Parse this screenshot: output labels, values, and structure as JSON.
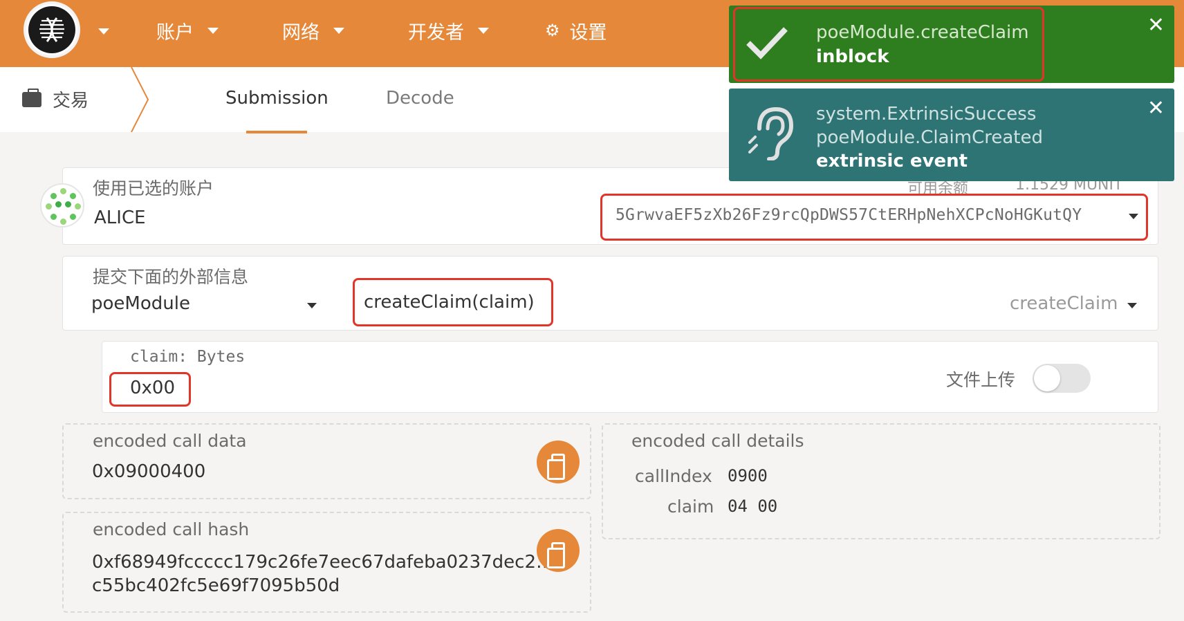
{
  "nav": {
    "items": [
      {
        "label": "账户"
      },
      {
        "label": "网络"
      },
      {
        "label": "开发者"
      },
      {
        "label": "设置"
      }
    ]
  },
  "subnav": {
    "app_label": "交易",
    "tabs": [
      {
        "label": "Submission",
        "active": true
      },
      {
        "label": "Decode",
        "active": false
      }
    ]
  },
  "account": {
    "label": "使用已选的账户",
    "name": "ALICE",
    "balance_label": "可用余额",
    "balance_value": "1.1529 MUNIT",
    "address": "5GrwvaEF5zXb26Fz9rcQpDWS57CtERHpNehXCPcNoHGKutQY"
  },
  "extrinsic": {
    "label": "提交下面的外部信息",
    "module": "poeModule",
    "call": "createClaim(claim)",
    "call_short": "createClaim"
  },
  "param": {
    "label": "claim: Bytes",
    "value": "0x00",
    "upload_label": "文件上传"
  },
  "encoded": {
    "call_data_label": "encoded call data",
    "call_data": "0x09000400",
    "details_label": "encoded call details",
    "call_index_label": "callIndex",
    "call_index_value": "0900",
    "claim_label": "claim",
    "claim_value": "04 00",
    "hash_label": "encoded call hash",
    "hash_line1": "0xf68949fccccc179c26fe7eec67dafeba0237dec2…",
    "hash_line2": "c55bc402fc5e69f7095b50d"
  },
  "notifications": [
    {
      "title": "poeModule.createClaim",
      "status": "inblock",
      "color": "#2e7d1f"
    },
    {
      "line1": "system.ExtrinsicSuccess",
      "line2": "poeModule.ClaimCreated",
      "status": "extrinsic event",
      "color": "#2e7475"
    }
  ],
  "colors": {
    "brand": "#e6883a",
    "highlight": "#e2352a"
  }
}
